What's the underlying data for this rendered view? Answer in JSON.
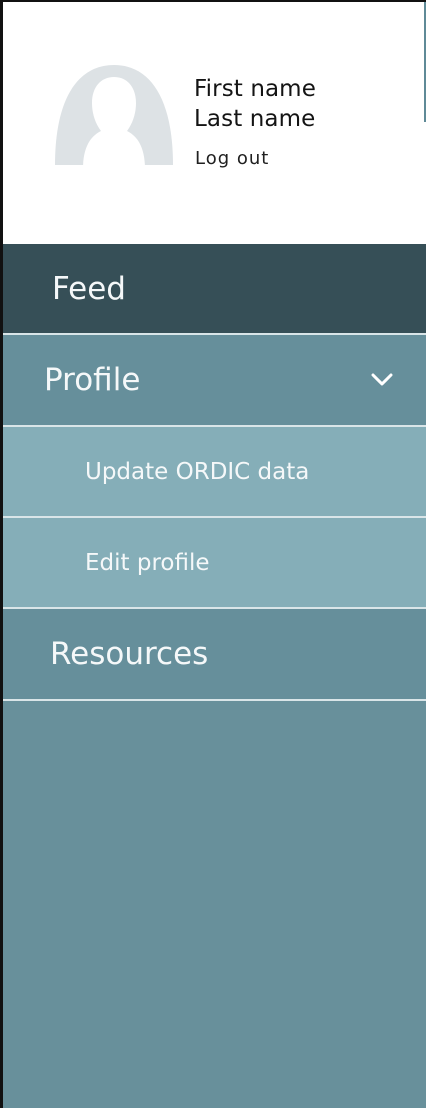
{
  "user": {
    "first_name": "First name",
    "last_name": "Last name",
    "logout_label": "Log out",
    "avatar_icon": "avatar-placeholder-icon"
  },
  "nav": {
    "feed_label": "Feed",
    "profile_label": "Profile",
    "profile_chevron_icon": "chevron-down-icon",
    "submenu": [
      {
        "label": "Update ORDIC data"
      },
      {
        "label": "Edit profile"
      }
    ],
    "resources_label": "Resources"
  },
  "colors": {
    "header_bg": "#ffffff",
    "feed_active_bg": "#364f57",
    "primary_nav_bg": "#668f9b",
    "submenu_bg": "#85aeb8",
    "drawer_bg": "#68909b",
    "divider": "#d9e5e8",
    "text_light": "#f5f8f9",
    "avatar_gray": "#dde2e5"
  }
}
